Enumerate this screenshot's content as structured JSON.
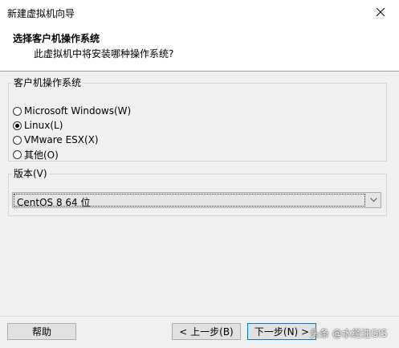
{
  "window": {
    "title": "新建虚拟机向导"
  },
  "header": {
    "title": "选择客户机操作系统",
    "subtitle": "此虚拟机中将安装哪种操作系统?"
  },
  "os_group": {
    "legend": "客户机操作系统",
    "options": [
      {
        "label": "Microsoft Windows(W)",
        "checked": false
      },
      {
        "label": "Linux(L)",
        "checked": true
      },
      {
        "label": "VMware ESX(X)",
        "checked": false
      },
      {
        "label": "其他(O)",
        "checked": false
      }
    ]
  },
  "version_group": {
    "legend": "版本(V)",
    "selected": "CentOS 8 64 位"
  },
  "buttons": {
    "help": "帮助",
    "back": "< 上一步(B)",
    "next": "下一步(N) >"
  },
  "watermark": "头条 @水经注GIS"
}
